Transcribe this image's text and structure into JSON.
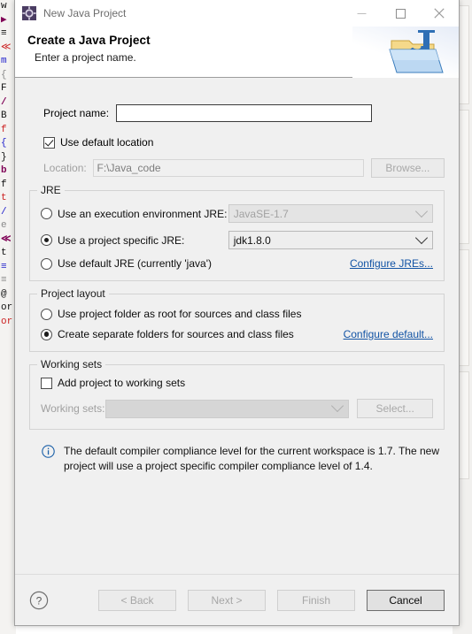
{
  "window": {
    "title": "New Java Project",
    "icon": "java-project-icon",
    "controls": {
      "minimize": "minimize-icon",
      "maximize": "maximize-icon",
      "close": "close-icon"
    }
  },
  "header": {
    "title": "Create a Java Project",
    "subtitle": "Enter a project name.",
    "graphic": "java-project-folder-icon"
  },
  "form": {
    "project_name": {
      "label": "Project name:",
      "value": "",
      "placeholder": ""
    },
    "use_default_location": {
      "label": "Use default location",
      "checked": true
    },
    "location": {
      "label": "Location:",
      "value": "F:\\Java_code",
      "enabled": false,
      "browse_label": "Browse..."
    }
  },
  "jre": {
    "group_title": "JRE",
    "options": [
      {
        "label": "Use an execution environment JRE:",
        "selected": false,
        "combo_value": "JavaSE-1.7",
        "combo_enabled": false
      },
      {
        "label": "Use a project specific JRE:",
        "selected": true,
        "combo_value": "jdk1.8.0",
        "combo_enabled": true
      },
      {
        "label": "Use default JRE (currently 'java')",
        "selected": false
      }
    ],
    "configure_link": "Configure JREs..."
  },
  "project_layout": {
    "group_title": "Project layout",
    "options": [
      {
        "label": "Use project folder as root for sources and class files",
        "selected": false
      },
      {
        "label": "Create separate folders for sources and class files",
        "selected": true
      }
    ],
    "configure_link": "Configure default..."
  },
  "working_sets": {
    "group_title": "Working sets",
    "add_checkbox": {
      "label": "Add project to working sets",
      "checked": false
    },
    "combo_label": "Working sets:",
    "combo_value": "",
    "combo_enabled": false,
    "select_label": "Select..."
  },
  "info": {
    "icon": "info-icon",
    "message": "The default compiler compliance level for the current workspace is 1.7. The new project will use a project specific compiler compliance level of 1.4."
  },
  "footer": {
    "help_label": "?",
    "buttons": [
      {
        "label": "< Back",
        "enabled": false
      },
      {
        "label": "Next >",
        "enabled": false
      },
      {
        "label": "Finish",
        "enabled": false
      },
      {
        "label": "Cancel",
        "enabled": true
      }
    ]
  },
  "colors": {
    "link": "#1354a5",
    "dialog_bg": "#f0f0f0",
    "header_bg": "#ffffff",
    "accent_info": "#1a5fa8"
  },
  "background_ide": {
    "left_lines": [
      "w",
      "▶",
      "≡",
      "≪",
      "m",
      "{",
      "F",
      "/",
      "B",
      "f",
      "{",
      "",
      "}",
      "b",
      "f",
      "t",
      "/",
      "e",
      "",
      "≪",
      "t",
      "",
      "≡",
      "≡",
      "@",
      "",
      "or",
      "or"
    ],
    "right_visible": true
  }
}
